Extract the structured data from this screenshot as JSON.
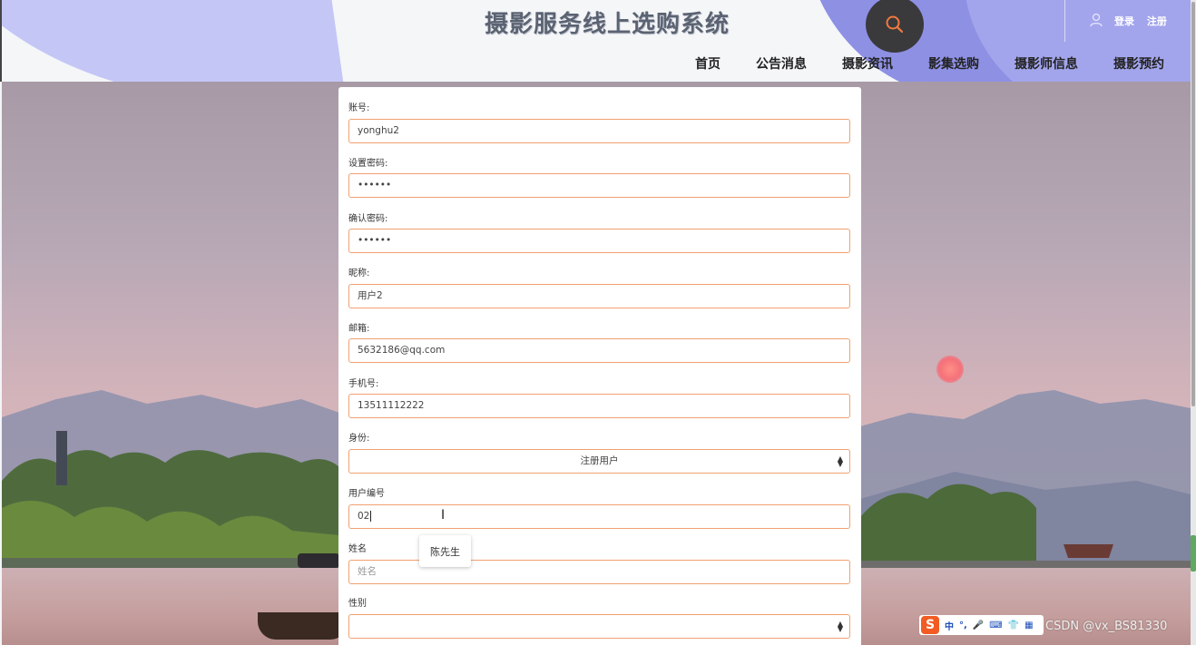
{
  "header": {
    "title": "摄影服务线上选购系统",
    "auth": {
      "login": "登录",
      "register": "注册"
    },
    "nav": [
      "首页",
      "公告消息",
      "摄影资讯",
      "影集选购",
      "摄影师信息",
      "摄影预约"
    ]
  },
  "form": {
    "fields": [
      {
        "label": "账号:",
        "value": "yonghu2"
      },
      {
        "label": "设置密码:",
        "value": "••••••"
      },
      {
        "label": "确认密码:",
        "value": "••••••"
      },
      {
        "label": "昵称:",
        "value": "用户2"
      },
      {
        "label": "邮箱:",
        "value": "5632186@qq.com"
      },
      {
        "label": "手机号:",
        "value": "13511112222"
      },
      {
        "label": "身份:",
        "value": "注册用户"
      },
      {
        "label": "用户编号",
        "value": "02"
      },
      {
        "label": "姓名",
        "placeholder": "姓名"
      },
      {
        "label": "性别",
        "value": ""
      }
    ],
    "suggestion": "陈先生"
  },
  "ime": {
    "items": [
      "中",
      "°,",
      "🎤",
      "⌨",
      "👕",
      "▦"
    ]
  },
  "watermark": "CSDN @vx_BS81330",
  "colors": {
    "accent_border": "#f0a070",
    "header_purple": "#8e90e4"
  }
}
